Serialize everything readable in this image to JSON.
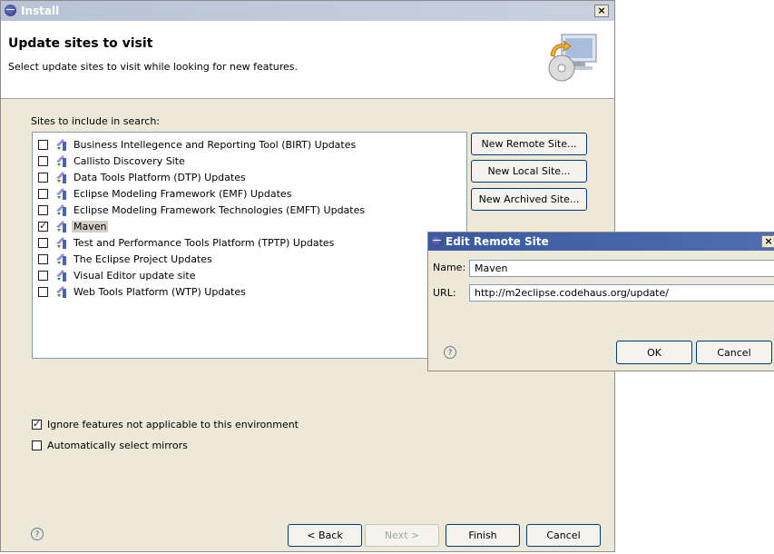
{
  "window": {
    "title": "Install"
  },
  "header": {
    "title": "Update sites to visit",
    "subtitle": "Select update sites to visit while looking for new features."
  },
  "sites": {
    "group_label": "Sites to include in search:",
    "items": [
      {
        "label": "Business Intellegence and Reporting Tool (BIRT) Updates",
        "checked": false
      },
      {
        "label": "Callisto Discovery Site",
        "checked": false
      },
      {
        "label": "Data Tools Platform (DTP) Updates",
        "checked": false
      },
      {
        "label": "Eclipse Modeling Framework (EMF) Updates",
        "checked": false
      },
      {
        "label": "Eclipse Modeling Framework Technologies (EMFT) Updates",
        "checked": false
      },
      {
        "label": "Maven",
        "checked": true
      },
      {
        "label": "Test and Performance Tools Platform (TPTP) Updates",
        "checked": false
      },
      {
        "label": "The Eclipse Project Updates",
        "checked": false
      },
      {
        "label": "Visual Editor update site",
        "checked": false
      },
      {
        "label": "Web Tools Platform (WTP) Updates",
        "checked": false
      }
    ]
  },
  "side_buttons": {
    "new_remote": "New Remote Site...",
    "new_local": "New Local Site...",
    "new_archived": "New Archived Site..."
  },
  "options": {
    "ignore_features": {
      "label": "Ignore features not applicable to this environment",
      "checked": true
    },
    "auto_mirrors": {
      "label": "Automatically select mirrors",
      "checked": false
    }
  },
  "footer": {
    "help_glyph": "?",
    "back": "< Back",
    "next": "Next >",
    "finish": "Finish",
    "cancel": "Cancel"
  },
  "edit_dialog": {
    "title": "Edit Remote Site",
    "name_label": "Name:",
    "name_value": "Maven",
    "url_label": "URL:",
    "url_value": "http://m2eclipse.codehaus.org/update/",
    "help_glyph": "?",
    "ok": "OK",
    "cancel": "Cancel"
  },
  "close_glyph": "×",
  "colors": {
    "title_active": "#3a5aa0",
    "title_inactive": "#b8c3d6",
    "face": "#ece9d8"
  }
}
